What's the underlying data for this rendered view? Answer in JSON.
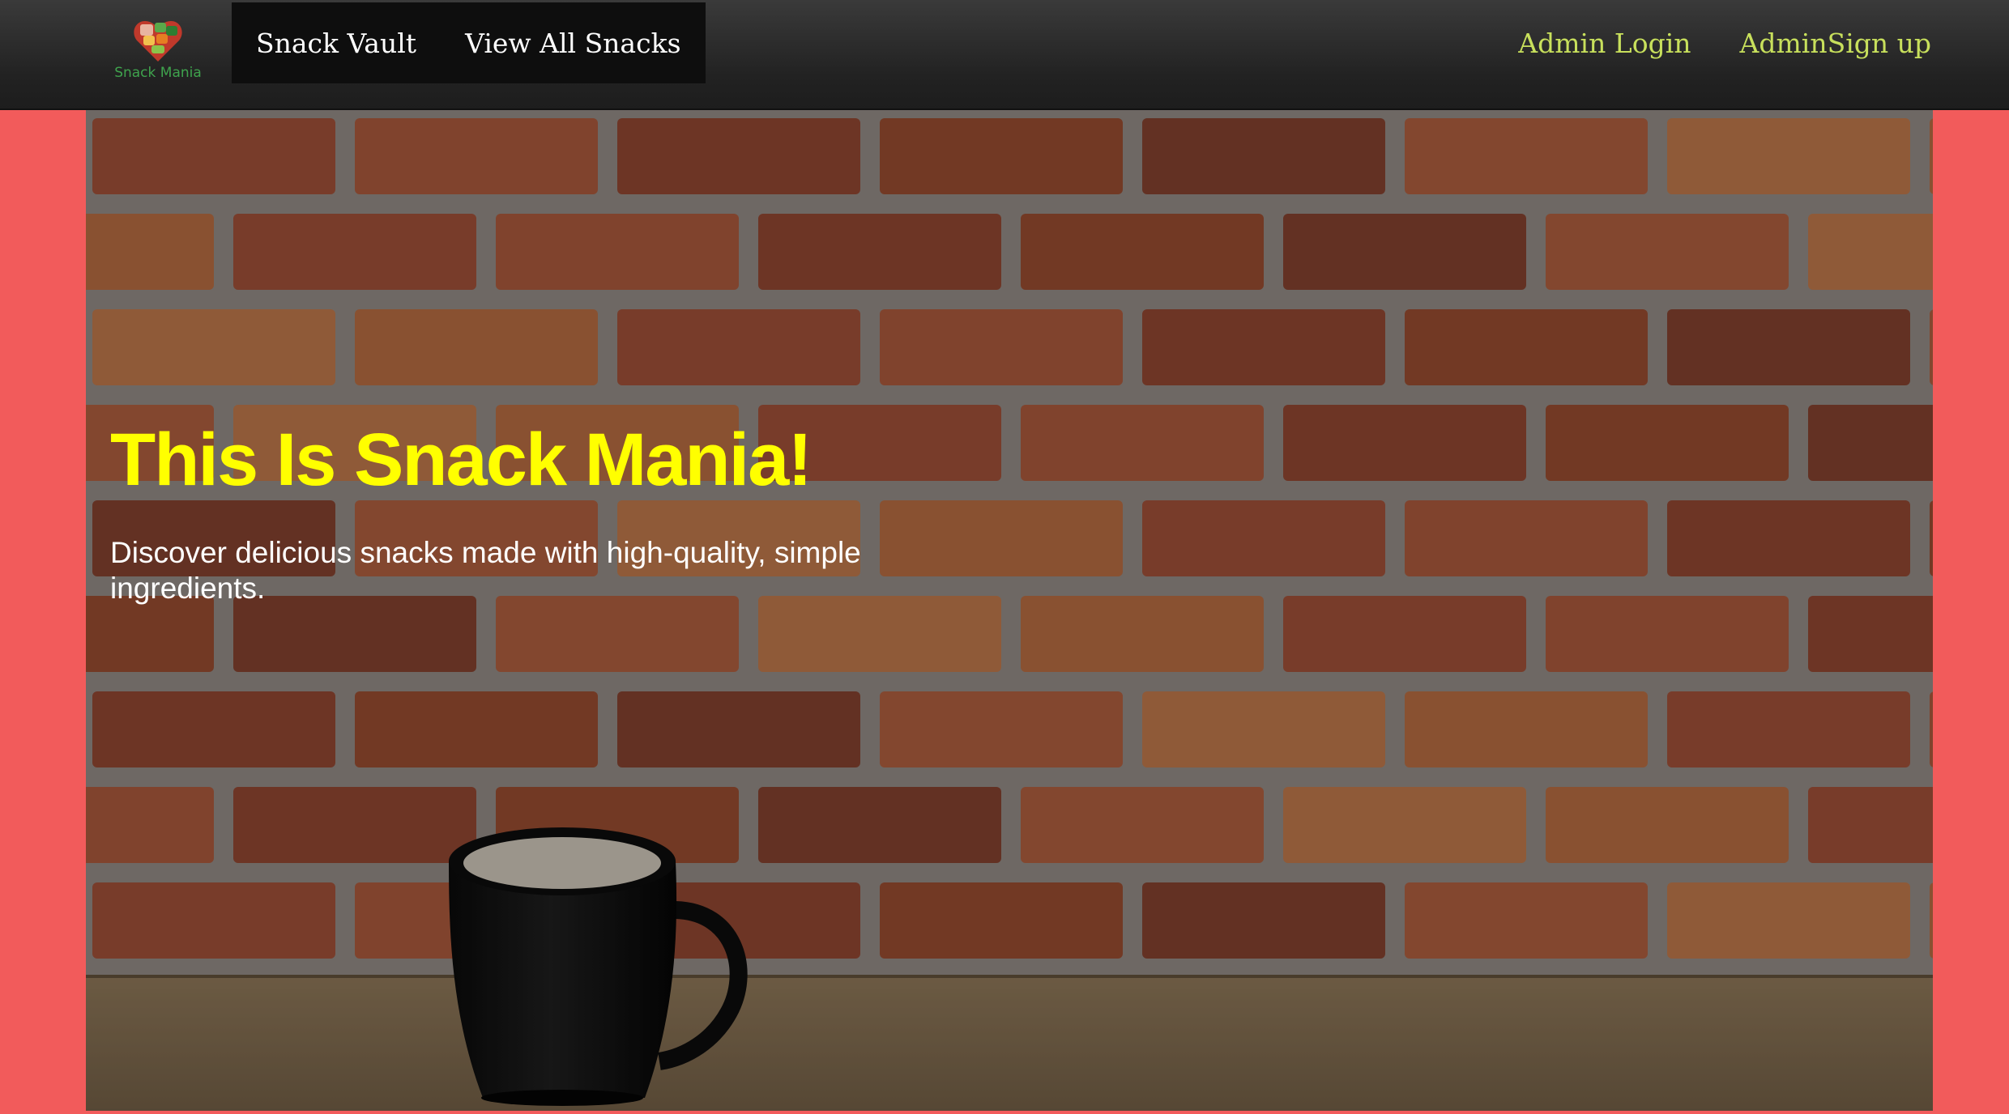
{
  "brand": {
    "name": "Snack Mania",
    "logo_icon": "heart-fruit-basket-icon"
  },
  "nav": {
    "left": [
      {
        "label": "Snack Vault"
      },
      {
        "label": "View All Snacks"
      }
    ],
    "right": [
      {
        "label": "Admin Login"
      },
      {
        "label": "AdminSign up"
      }
    ]
  },
  "hero": {
    "title": "This Is Snack Mania!",
    "subtitle": "Discover delicious snacks made with high-quality, simple ingredients.",
    "background": "brick-wall-with-coffee-mug"
  },
  "colors": {
    "page_bg": "#f25b5b",
    "navbar_bg": "#222222",
    "nav_active_bg": "#0e0e0e",
    "nav_link": "#ffffff",
    "admin_link": "#c8e05c",
    "title": "#ffff00",
    "subtitle": "#ffffff"
  }
}
